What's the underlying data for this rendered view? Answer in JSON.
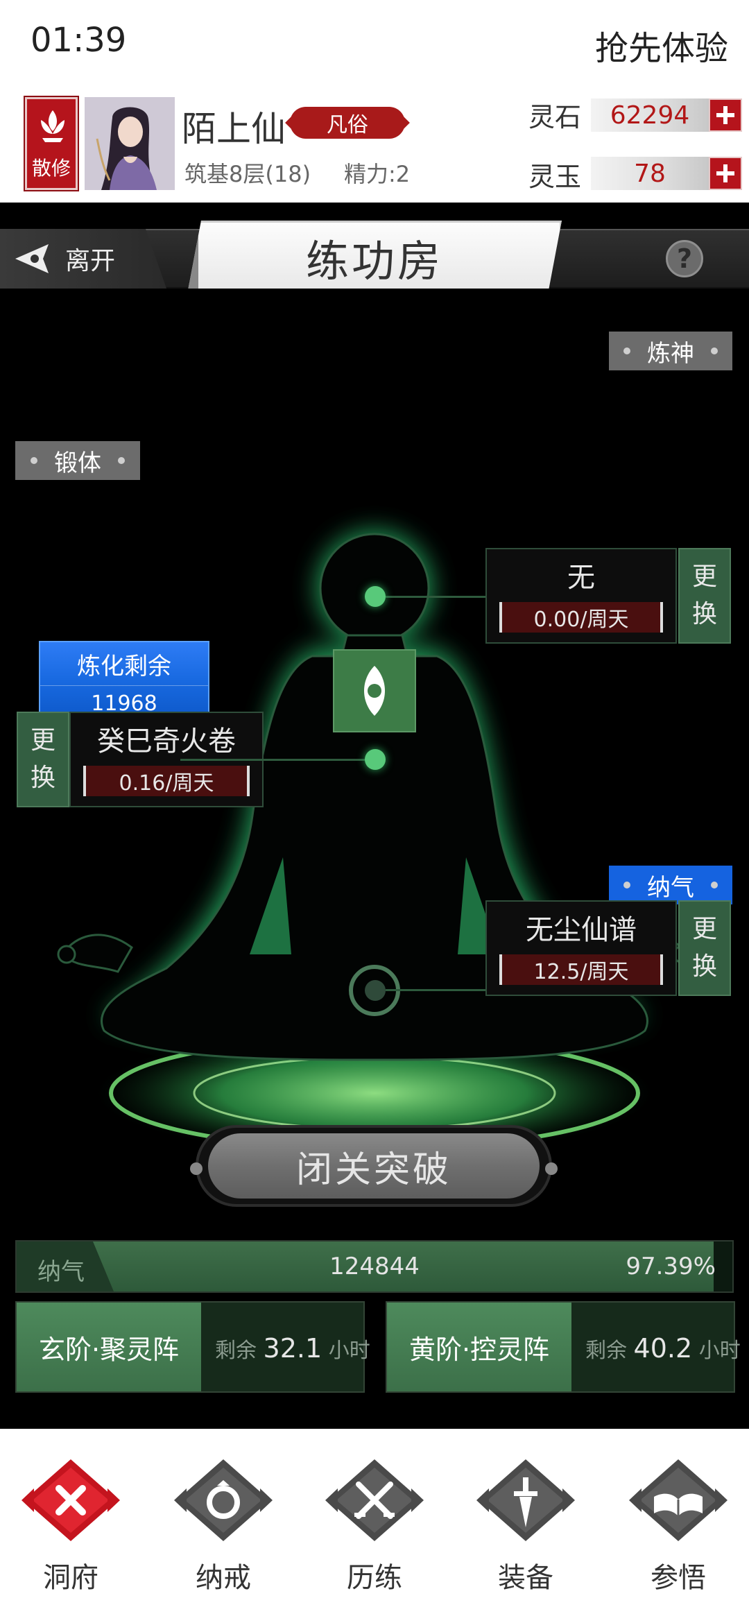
{
  "status_bar": {
    "time": "01:39",
    "promo": "抢先体验"
  },
  "header": {
    "sect": "散修",
    "player_name": "陌上仙",
    "rank": "凡俗",
    "realm": "筑基8层(18)",
    "energy": "精力:2",
    "currencies": [
      {
        "label": "灵石",
        "value": "62294"
      },
      {
        "label": "灵玉",
        "value": "78"
      }
    ],
    "plus_icon": "plus-icon"
  },
  "titlebar": {
    "leave": "离开",
    "title": "练功房",
    "help": "?"
  },
  "refine": {
    "label": "炼化剩余",
    "value": "11968"
  },
  "slots": {
    "shen": {
      "tag": "炼神",
      "name": "无",
      "rate": "0.00/周天",
      "swap": [
        "更",
        "换"
      ]
    },
    "body": {
      "tag": "锻体",
      "name": "癸巳奇火卷",
      "rate": "0.16/周天",
      "swap": [
        "更",
        "换"
      ]
    },
    "qi": {
      "tag": "纳气",
      "name": "无尘仙谱",
      "rate": "12.5/周天",
      "swap": [
        "更",
        "换"
      ]
    }
  },
  "breakthrough_label": "闭关突破",
  "qi_bar": {
    "label": "纳气",
    "value": "124844",
    "percent": "97.39%",
    "fill_fraction": 0.9739
  },
  "arrays": [
    {
      "name": "玄阶·聚灵阵",
      "remain_prefix": "剩余",
      "remain_value": "32.1",
      "remain_unit": "小时"
    },
    {
      "name": "黄阶·控灵阵",
      "remain_prefix": "剩余",
      "remain_value": "40.2",
      "remain_unit": "小时"
    }
  ],
  "nav": [
    {
      "label": "洞府",
      "icon": "cave-x-icon",
      "color": "#c4141e"
    },
    {
      "label": "纳戒",
      "icon": "ring-icon",
      "color": "#555555"
    },
    {
      "label": "历练",
      "icon": "crossed-swords-icon",
      "color": "#555555"
    },
    {
      "label": "装备",
      "icon": "dagger-icon",
      "color": "#555555"
    },
    {
      "label": "参悟",
      "icon": "open-book-icon",
      "color": "#555555"
    }
  ],
  "colors": {
    "accent_red": "#b5141c",
    "accent_blue": "#1563e0",
    "jade_green": "#3d7c47",
    "glow_green": "#2fd67a"
  }
}
